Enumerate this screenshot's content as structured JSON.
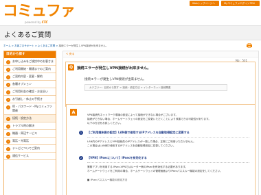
{
  "header": {
    "logo_text": "コミュファ",
    "logo_sub": "powered by",
    "logo_brand": "ctc",
    "btn_home": "Webトップページへ",
    "btn_mypage": "MyコミュファログインTEN"
  },
  "page_title": "よくあるご質問",
  "breadcrumb": {
    "items": [
      "ホーム",
      "お客さまサポート",
      "よくあるご質問"
    ],
    "sep": " > ",
    "current": "接続エラーが発生しVPN接続が出来ません。"
  },
  "sidebar": {
    "heading": "目的から探す",
    "items": [
      "お申し込みをご検討中のお客さま",
      "ご利用開始・開通までのご案内",
      "ご契約内容・変更・解約",
      "各種オプション",
      "ご利用料金の確認・お支払い",
      "お引越し・休止の手続き",
      "ID・パスワード・Myコミュファ関連",
      "接続・設定方法",
      "トラブル時の解決",
      "機器・周辺サービス",
      "電話・光電話",
      "テレビについてご案内",
      "通信サービス"
    ]
  },
  "main": {
    "back": "< 戻る",
    "no_label": "No：531",
    "q_badge": "Q",
    "q_title": "接続エラーが発生しVPN接続が出来ません。",
    "q_sub": "接続エラーが発生しVPN接続が出来ません。",
    "category": "カテゴリー：目的から探す > 接続・設定方法 > インターネット接続関連",
    "a_badge": "A",
    "a_lines": [
      "VPN接続先ネットワーク環境の設定によって接続ができない場合がございます。",
      "接続ができない場合、ホームゲートウェイの設定をご変更いただくことにより改善できる可能性があります。",
      "以下の方法をお試しください。"
    ],
    "sections": [
      {
        "num": "1",
        "heading": "【ご利用端末側の設定】LAN側で使用するIPアドレスを自動取得設定に変更する",
        "lines": [
          "LAN内のIPアドレスとVPN接続先のIPアドレスが一致した場合、正常にご利用いただけません。",
          "この場合はLAN側で使用するIPアドレスを自動取得設定に変更してください。"
        ]
      },
      {
        "num": "2",
        "heading": "【VPN】IPsecについて】IPsecを有効化する",
        "lines": [
          "業務アプリを利用する IPsec-VPNではルーター側のIPsecを有効化する必要があります。",
          "ホームゲートウェイをご利用の場合、ホームゲートウェイの管理画面よりIPsecパススルー機能の設定をしてください。"
        ]
      }
    ],
    "note": "■ IPsecパススルー機能の設定方法"
  },
  "colors": {
    "accent": "#ee7d00",
    "nav_blue": "#1f3c88",
    "link": "#0b5aa2"
  }
}
